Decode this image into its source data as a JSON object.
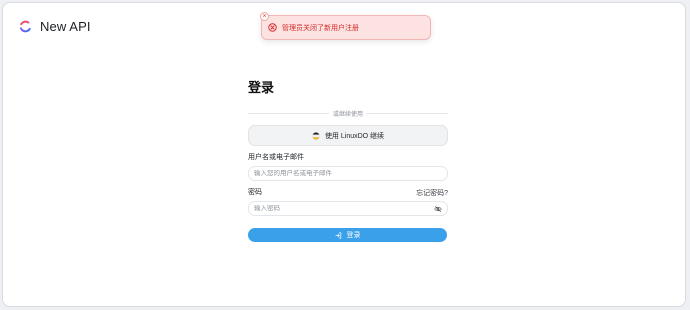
{
  "app": {
    "name": "New API",
    "logo_icon": "new-api-logo-icon"
  },
  "toast": {
    "message": "管理员关闭了新用户注册",
    "close_glyph": "×",
    "icon": "error-circle-icon",
    "color": "#d42a2a"
  },
  "login": {
    "title": "登录",
    "divider_text": "或继续使用",
    "oauth_button_label": "使用 LinuxDO 继续",
    "username_label": "用户名或电子邮件",
    "username_placeholder": "输入您的用户名或电子邮件",
    "password_label": "密码",
    "forgot_password_link": "忘记密码?",
    "password_placeholder": "输入密码",
    "submit_label": "登录",
    "accent_color": "#3ba0ea"
  }
}
